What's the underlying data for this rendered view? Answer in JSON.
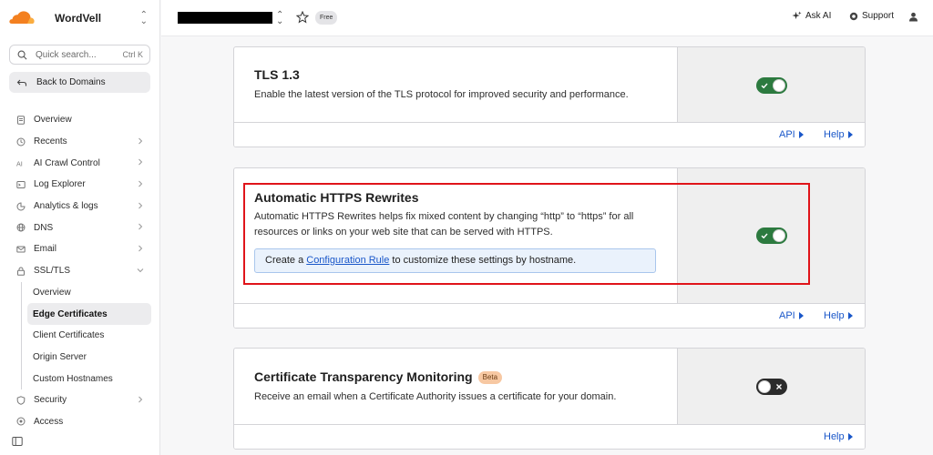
{
  "account": {
    "name": "WordVell",
    "switch_glyph": "⌃⌄"
  },
  "sidebar": {
    "search_placeholder": "Quick search...",
    "search_shortcut": "Ctrl K",
    "back_label": "Back to Domains",
    "items": [
      {
        "label": "Overview",
        "icon": "overview-icon",
        "has_chevron": false
      },
      {
        "label": "Recents",
        "icon": "clock-icon",
        "has_chevron": true
      },
      {
        "label": "AI Crawl Control",
        "icon": "ai-icon",
        "has_chevron": true
      },
      {
        "label": "Log Explorer",
        "icon": "log-icon",
        "has_chevron": true
      },
      {
        "label": "Analytics & logs",
        "icon": "analytics-icon",
        "has_chevron": true
      },
      {
        "label": "DNS",
        "icon": "dns-icon",
        "has_chevron": true
      },
      {
        "label": "Email",
        "icon": "email-icon",
        "has_chevron": true
      },
      {
        "label": "SSL/TLS",
        "icon": "lock-icon",
        "has_chevron": true,
        "expanded": true
      }
    ],
    "ssl_sub_items": [
      {
        "label": "Overview",
        "active": false
      },
      {
        "label": "Edge Certificates",
        "active": true
      },
      {
        "label": "Client Certificates",
        "active": false
      },
      {
        "label": "Origin Server",
        "active": false
      },
      {
        "label": "Custom Hostnames",
        "active": false
      }
    ],
    "items_after": [
      {
        "label": "Security",
        "icon": "shield-icon",
        "has_chevron": true
      },
      {
        "label": "Access",
        "icon": "access-icon",
        "has_chevron": false
      }
    ]
  },
  "topbar": {
    "plan_badge": "Free",
    "ask_ai": "Ask AI",
    "support": "Support"
  },
  "cards": {
    "tls13": {
      "title": "TLS 1.3",
      "description": "Enable the latest version of the TLS protocol for improved security and performance.",
      "enabled": true,
      "api_label": "API",
      "help_label": "Help"
    },
    "https_rewrites": {
      "title": "Automatic HTTPS Rewrites",
      "description": "Automatic HTTPS Rewrites helps fix mixed content by changing “http” to “https” for all resources or links on your web site that can be served with HTTPS.",
      "notice_prefix": "Create a ",
      "notice_link": "Configuration Rule",
      "notice_suffix": " to customize these settings by hostname.",
      "enabled": true,
      "api_label": "API",
      "help_label": "Help"
    },
    "ct_monitoring": {
      "title": "Certificate Transparency Monitoring",
      "badge": "Beta",
      "description": "Receive an email when a Certificate Authority issues a certificate for your domain.",
      "enabled": false,
      "help_label": "Help"
    }
  },
  "colors": {
    "toggle_on": "#2c7a3f",
    "toggle_off": "#2b2b2b",
    "link": "#1a57c9",
    "highlight": "#e0141a",
    "brand": "#f38020"
  }
}
